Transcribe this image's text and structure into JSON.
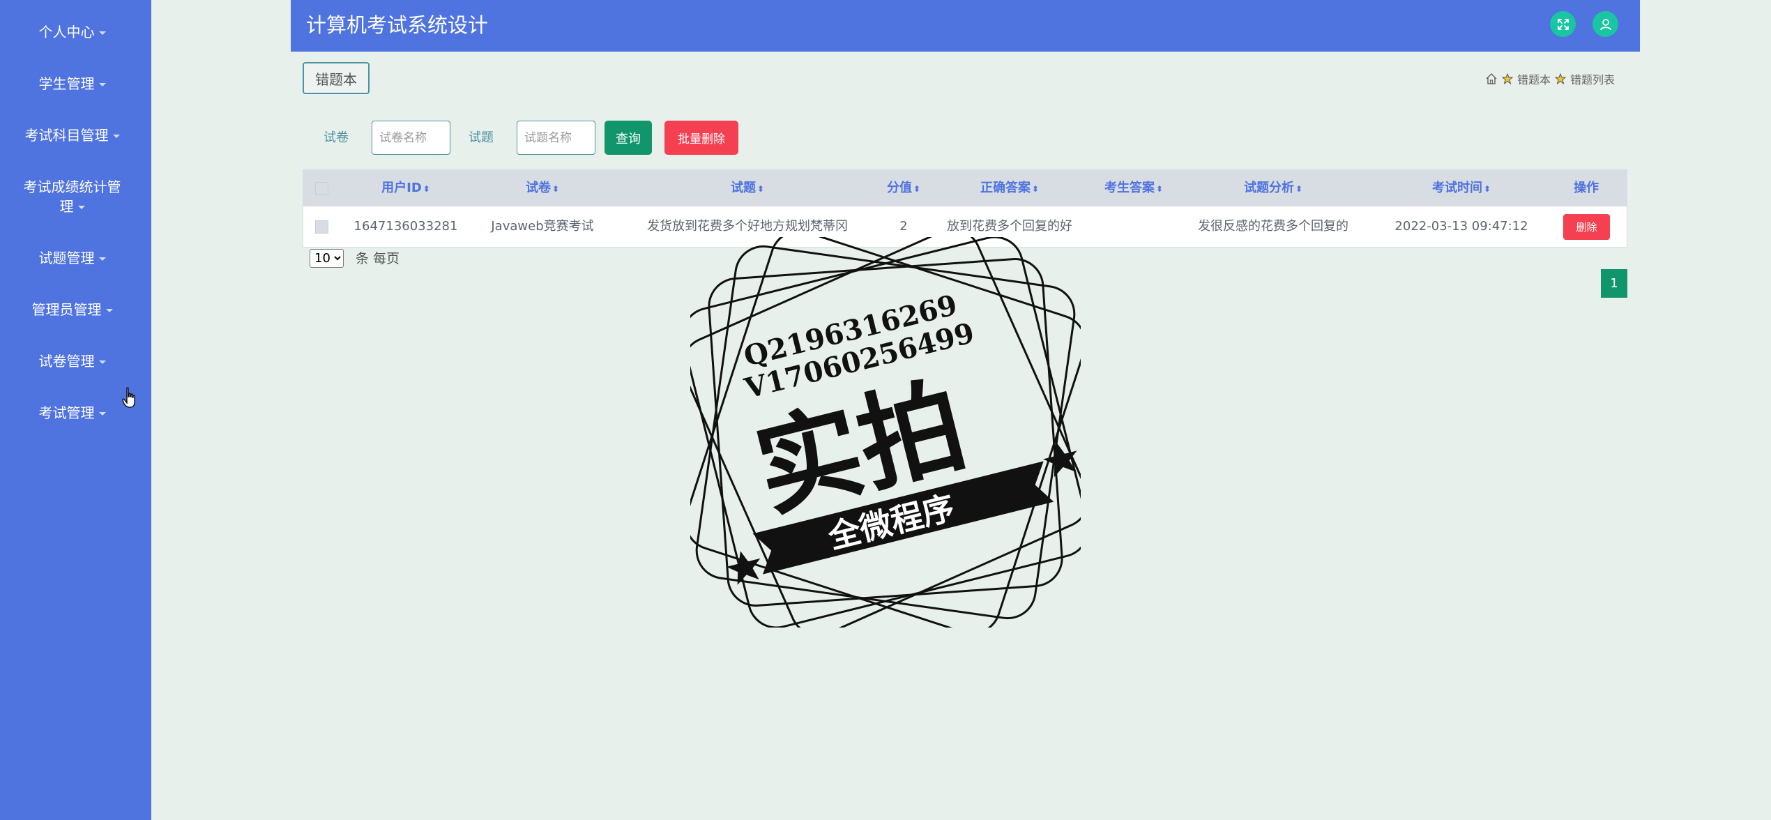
{
  "sidebar": {
    "items": [
      {
        "label": "个人中心"
      },
      {
        "label": "学生管理"
      },
      {
        "label": "考试科目管理"
      },
      {
        "label": "考试成绩统计管"
      },
      {
        "label": "试题管理"
      },
      {
        "label": "管理员管理"
      },
      {
        "label": "试卷管理"
      },
      {
        "label": "考试管理"
      }
    ],
    "item4_line2": "理"
  },
  "header": {
    "title": "计算机考试系统设计",
    "accent_color": "#19c5a3",
    "background_color": "#4f73df"
  },
  "tab": {
    "label": "错题本"
  },
  "breadcrumb": {
    "level1": "错题本",
    "level2": "错题列表"
  },
  "search": {
    "paper_label": "试卷",
    "paper_placeholder": "试卷名称",
    "question_label": "试题",
    "question_placeholder": "试题名称",
    "query_button": "查询",
    "batch_delete_button": "批量删除"
  },
  "table": {
    "columns": [
      "用户ID",
      "试卷",
      "试题",
      "分值",
      "正确答案",
      "考生答案",
      "试题分析",
      "考试时间",
      "操作"
    ],
    "rows": [
      {
        "user_id": "1647136033281",
        "paper": "Javaweb竞赛考试",
        "question": "发货放到花费多个好地方规划梵蒂冈",
        "score": "2",
        "correct_answer": "放到花费多个回复的好",
        "student_answer": "",
        "analysis": "发很反感的花费多个回复的",
        "exam_time": "2022-03-13 09:47:12",
        "action": "删除"
      }
    ]
  },
  "pagination": {
    "page_size": "10",
    "per_page_label": "条 每页",
    "current_page": "1"
  },
  "watermark": {
    "line1": "Q2196316269",
    "line2": "V17060256499",
    "big_text": "实拍",
    "ribbon_text": "全微程序"
  }
}
